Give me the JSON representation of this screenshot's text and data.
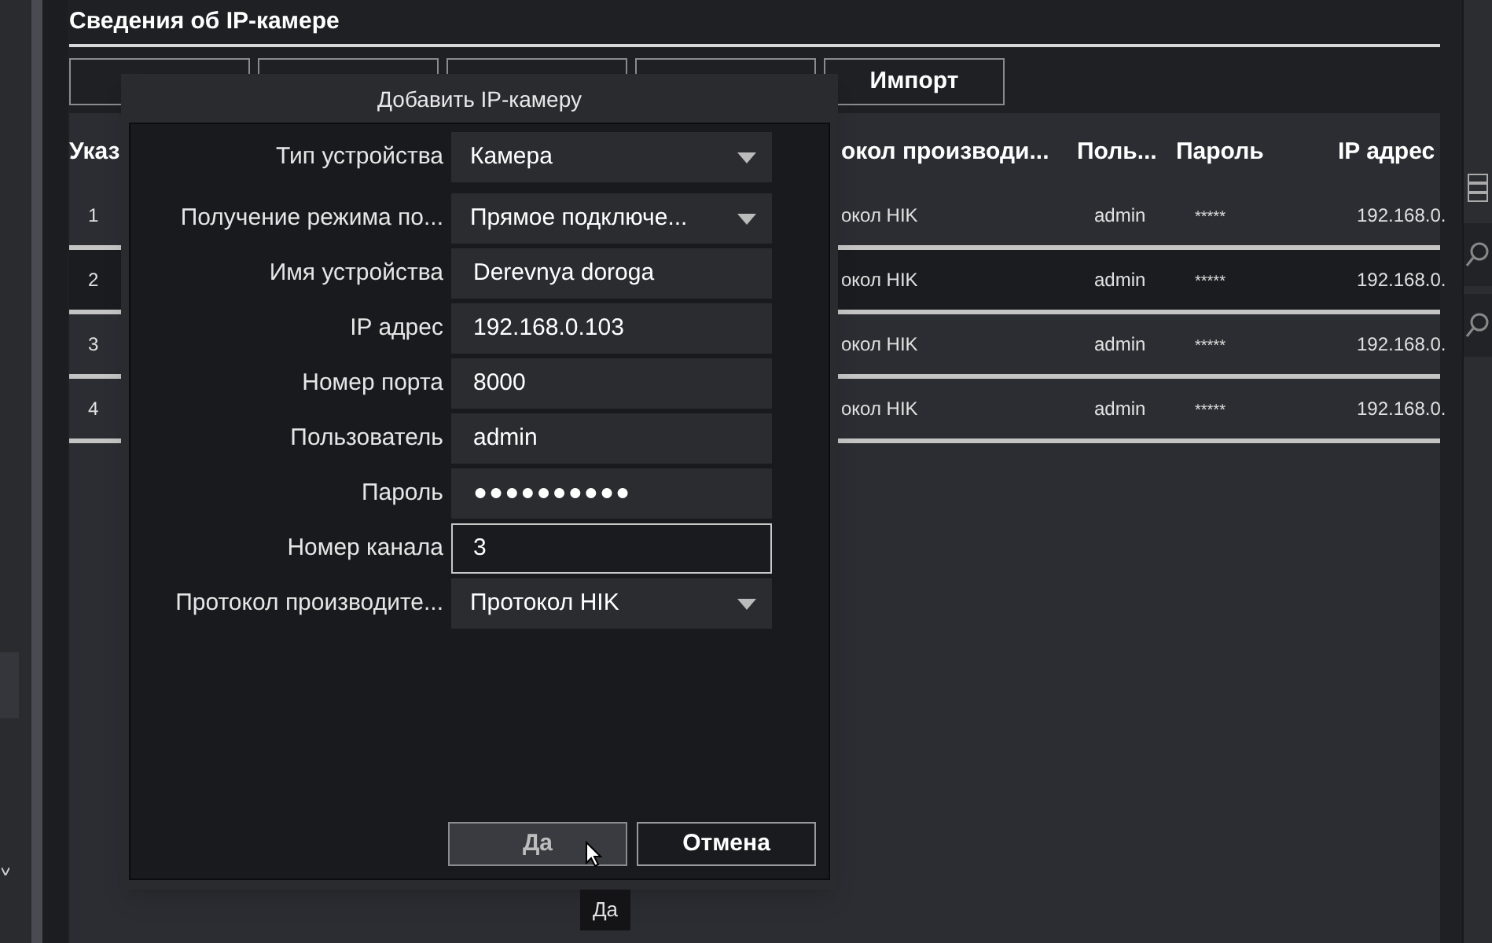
{
  "panel": {
    "title": "Сведения об IP-камере",
    "toolbar": {
      "buttons": [
        "Импорт"
      ]
    }
  },
  "table": {
    "columns": [
      "Указ",
      "окол производи...",
      "Поль...",
      "Пароль",
      "IP адрес"
    ],
    "rows": [
      {
        "cells": [
          "1",
          "окол HIK",
          "admin",
          "*****",
          "192.168.0."
        ],
        "selected": false
      },
      {
        "cells": [
          "2",
          "окол HIK",
          "admin",
          "*****",
          "192.168.0."
        ],
        "selected": true
      },
      {
        "cells": [
          "3",
          "окол HIK",
          "admin",
          "*****",
          "192.168.0."
        ],
        "selected": false
      },
      {
        "cells": [
          "4",
          "окол HIK",
          "admin",
          "*****",
          "192.168.0."
        ],
        "selected": false
      }
    ]
  },
  "dialog": {
    "title": "Добавить IP-камеру",
    "fields": [
      {
        "label": "Тип устройства",
        "value": "Камера",
        "kind": "dropdown",
        "focused": false
      },
      {
        "label": "Получение режима по...",
        "value": "Прямое подключе...",
        "kind": "dropdown",
        "focused": false
      },
      {
        "label": "Имя устройства",
        "value": "Derevnya doroga",
        "kind": "text",
        "focused": false
      },
      {
        "label": "IP адрес",
        "value": "192.168.0.103",
        "kind": "text",
        "focused": false
      },
      {
        "label": "Номер порта",
        "value": "8000",
        "kind": "text",
        "focused": false
      },
      {
        "label": "Пользователь",
        "value": "admin",
        "kind": "text",
        "focused": false
      },
      {
        "label": "Пароль",
        "value": "●●●●●●●●●●",
        "kind": "password",
        "focused": false
      },
      {
        "label": "Номер канала",
        "value": "3",
        "kind": "text",
        "focused": true
      },
      {
        "label": "Протокол производите...",
        "value": "Протокол HIK",
        "kind": "dropdown",
        "focused": false
      }
    ],
    "buttons": [
      {
        "label": "Да",
        "hovered": true
      },
      {
        "label": "Отмена",
        "hovered": false
      }
    ],
    "tooltip": "Да"
  }
}
